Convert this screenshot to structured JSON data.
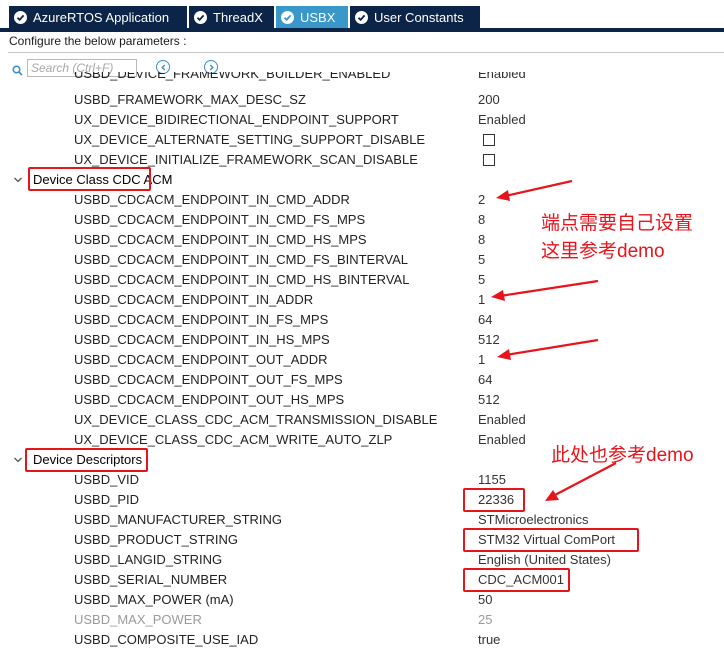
{
  "tabs": [
    {
      "label": "AzureRTOS Application",
      "active": false
    },
    {
      "label": "ThreadX",
      "active": false
    },
    {
      "label": "USBX",
      "active": true
    },
    {
      "label": "User Constants",
      "active": false
    }
  ],
  "config": {
    "label": "Configure the below parameters :"
  },
  "search": {
    "placeholder": "Search (Ctrl+F)"
  },
  "rows": [
    {
      "name": "USBD_DEVICE_FRAMEWORK_BUILDER_ENABLED",
      "value": "Enabled"
    },
    {
      "name": "USBD_FRAMEWORK_MAX_DESC_SZ",
      "value": "200"
    },
    {
      "name": "UX_DEVICE_BIDIRECTIONAL_ENDPOINT_SUPPORT",
      "value": "Enabled"
    },
    {
      "name": "UX_DEVICE_ALTERNATE_SETTING_SUPPORT_DISABLE",
      "value": ""
    },
    {
      "name": "UX_DEVICE_INITIALIZE_FRAMEWORK_SCAN_DISABLE",
      "value": ""
    },
    {
      "name": "Device Class CDC ACM",
      "value": ""
    },
    {
      "name": "USBD_CDCACM_ENDPOINT_IN_CMD_ADDR",
      "value": "2"
    },
    {
      "name": "USBD_CDCACM_ENDPOINT_IN_CMD_FS_MPS",
      "value": "8"
    },
    {
      "name": "USBD_CDCACM_ENDPOINT_IN_CMD_HS_MPS",
      "value": "8"
    },
    {
      "name": "USBD_CDCACM_ENDPOINT_IN_CMD_FS_BINTERVAL",
      "value": "5"
    },
    {
      "name": "USBD_CDCACM_ENDPOINT_IN_CMD_HS_BINTERVAL",
      "value": "5"
    },
    {
      "name": "USBD_CDCACM_ENDPOINT_IN_ADDR",
      "value": "1"
    },
    {
      "name": "USBD_CDCACM_ENDPOINT_IN_FS_MPS",
      "value": "64"
    },
    {
      "name": "USBD_CDCACM_ENDPOINT_IN_HS_MPS",
      "value": "512"
    },
    {
      "name": "USBD_CDCACM_ENDPOINT_OUT_ADDR",
      "value": "1"
    },
    {
      "name": "USBD_CDCACM_ENDPOINT_OUT_FS_MPS",
      "value": "64"
    },
    {
      "name": "USBD_CDCACM_ENDPOINT_OUT_HS_MPS",
      "value": "512"
    },
    {
      "name": "UX_DEVICE_CLASS_CDC_ACM_TRANSMISSION_DISABLE",
      "value": "Enabled"
    },
    {
      "name": "UX_DEVICE_CLASS_CDC_ACM_WRITE_AUTO_ZLP",
      "value": "Enabled"
    },
    {
      "name": "Device Descriptors",
      "value": ""
    },
    {
      "name": "USBD_VID",
      "value": "1155"
    },
    {
      "name": "USBD_PID",
      "value": "22336"
    },
    {
      "name": "USBD_MANUFACTURER_STRING",
      "value": "STMicroelectronics"
    },
    {
      "name": "USBD_PRODUCT_STRING",
      "value": "STM32 Virtual ComPort"
    },
    {
      "name": "USBD_LANGID_STRING",
      "value": "English (United States)"
    },
    {
      "name": "USBD_SERIAL_NUMBER",
      "value": "CDC_ACM001"
    },
    {
      "name": "USBD_MAX_POWER (mA)",
      "value": "50"
    },
    {
      "name": "USBD_MAX_POWER",
      "value": "25"
    },
    {
      "name": "USBD_COMPOSITE_USE_IAD",
      "value": "true"
    }
  ],
  "annotations": {
    "endpoint_note_line1": "端点需要自己设置",
    "endpoint_note_line2": "这里参考demo",
    "descriptor_note": "此处也参考demo"
  },
  "colors": {
    "tab_bg": "#0b2447",
    "tab_active": "#3a97c9",
    "highlight_red": "#e8141c",
    "nav_blue": "#3a8fc8"
  }
}
